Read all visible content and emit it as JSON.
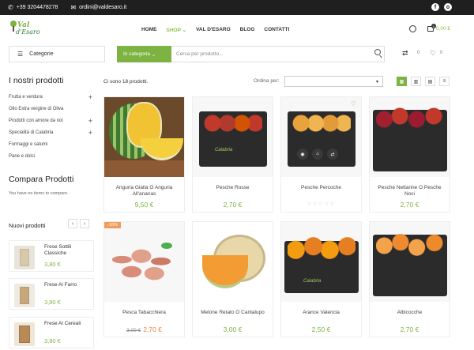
{
  "topbar": {
    "phone": "+39 3204478278",
    "email": "ordini@valdesaro.it",
    "social": [
      "f",
      "o"
    ]
  },
  "logo": {
    "line1": "Val",
    "line2": "d'Esaro"
  },
  "nav": [
    "HOME",
    "SHOP",
    "VAL D'ESARO",
    "BLOG",
    "CONTATTI"
  ],
  "cart": {
    "count": "0",
    "total": "0,00 €"
  },
  "search": {
    "categories_label": "Categorie",
    "in_category": "In categoria",
    "placeholder": "Cerca per prodotto..."
  },
  "counters": {
    "compare": "0",
    "wishlist": "0"
  },
  "sidebar": {
    "title": "I nostri prodotti",
    "items": [
      {
        "label": "Frutta e verdura",
        "expand": "+"
      },
      {
        "label": "Olio Extra vergine di Oliva",
        "expand": ""
      },
      {
        "label": "Prodotti con amore da noi",
        "expand": "+"
      },
      {
        "label": "Specialità di Calabria",
        "expand": "+"
      },
      {
        "label": "Formaggi e salumi",
        "expand": ""
      },
      {
        "label": "Pane e dolci",
        "expand": ""
      }
    ],
    "compare_title": "Compara Prodotti",
    "compare_text": "You have no items to compare.",
    "new_title": "Nuovi prodotti",
    "new_products": [
      {
        "name": "Frese Sottili Classiche",
        "price": "3,80 €"
      },
      {
        "name": "Frese Al Farro",
        "price": "3,80 €"
      },
      {
        "name": "Frese Al Cereali",
        "price": "3,80 €"
      }
    ]
  },
  "toolbar": {
    "count": "Ci sono 18 prodotti.",
    "order_label": "Ordina per:"
  },
  "products": [
    {
      "name": "Anguria Gialla O Anguria All'ananas",
      "price": "9,50 €"
    },
    {
      "name": "Pesche Rosse",
      "price": "2,70 €"
    },
    {
      "name": "Pesche Percoche",
      "price": "",
      "stars": "☆☆☆☆☆"
    },
    {
      "name": "Pesche Nettarine O Pesche Noci",
      "price": "2,70 €"
    },
    {
      "name": "Pesca Tabacchiera",
      "old_price": "3,00 €",
      "price": "2,70 €",
      "discount": "-10%"
    },
    {
      "name": "Melone Retato O Cantalupo",
      "price": "3,00 €"
    },
    {
      "name": "Arance Valencia",
      "price": "2,50 €"
    },
    {
      "name": "Albicocche",
      "price": "2,70 €"
    }
  ],
  "crate_brand": "Calabria",
  "colors": {
    "accent": "#7cb342",
    "sale": "#e9853e",
    "topbar": "#1f1f1f"
  }
}
